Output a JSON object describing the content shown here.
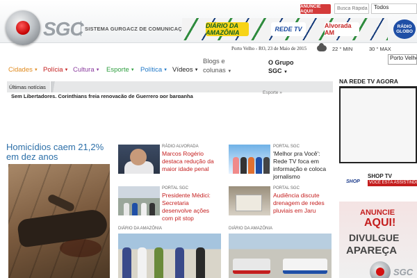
{
  "header": {
    "logo_text": "SGC",
    "logo_subtitle": "SISTEMA GURGACZ DE COMUNICAÇÃO",
    "partners": [
      "DIÁRIO DA AMAZÔNIA",
      "REDE TV",
      "Alvorada AM",
      "RÁDIO GLOBO"
    ],
    "anuncie_label": "ANUNCIE AQUI!",
    "search_placeholder": "Busca Rápida",
    "search_scope": "Todos"
  },
  "info_bar": {
    "date": "Porto Velho - RO, 23 de Maio de 2015",
    "temp_min": "22 ° MIN",
    "temp_max": "30 ° MAX",
    "city_select": "Porto Velho"
  },
  "nav": {
    "items": [
      {
        "label": "Cidades",
        "color": "#e08a1e"
      },
      {
        "label": "Polícia",
        "color": "#c41e1e"
      },
      {
        "label": "Cultura",
        "color": "#8a3b9e"
      },
      {
        "label": "Esporte",
        "color": "#2e9e3f"
      },
      {
        "label": "Política",
        "color": "#1f78c8"
      },
      {
        "label": "Vídeos",
        "color": "#222222"
      }
    ],
    "blogs_label": "Blogs e colunas",
    "grupo_label": "O Grupo SGC"
  },
  "ticker": {
    "label": "Últimas notícias",
    "headline": "Sem Libertadores, Corinthians freia renovação de Guerrero por barganha",
    "more": "Esporte »"
  },
  "featured": {
    "title": "Homicídios caem 21,2% em dez anos"
  },
  "news": [
    {
      "source": "RÁDIO ALVORADA",
      "title": "Marcos Rogério destaca redução da maior idade penal"
    },
    {
      "source": "PORTAL SGC",
      "title": "'Melhor pra Você': Rede TV foca em informação e coloca jornalismo"
    },
    {
      "source": "PORTAL SGC",
      "title": "Presidente Médici: Secretaria desenvolve ações com pit stop"
    },
    {
      "source": "PORTAL SGC",
      "title": "Audiência discute drenagem de redes pluviais em Jaru"
    },
    {
      "source": "DIÁRIO DA AMAZÔNIA",
      "title": ""
    },
    {
      "source": "DIÁRIO DA AMAZÔNIA",
      "title": ""
    }
  ],
  "sidebar": {
    "tv_heading": "NA REDE TV AGORA",
    "shop_logo": "SHOP",
    "shop_name": "SHOP TV",
    "shop_tag": "VOCÊ ESTÁ ASSISTINDO",
    "ad_lines": [
      "ANUNCIE",
      "AQUI!",
      "DIVULGUE",
      "APAREÇA"
    ],
    "ad_logo": "SGC"
  }
}
